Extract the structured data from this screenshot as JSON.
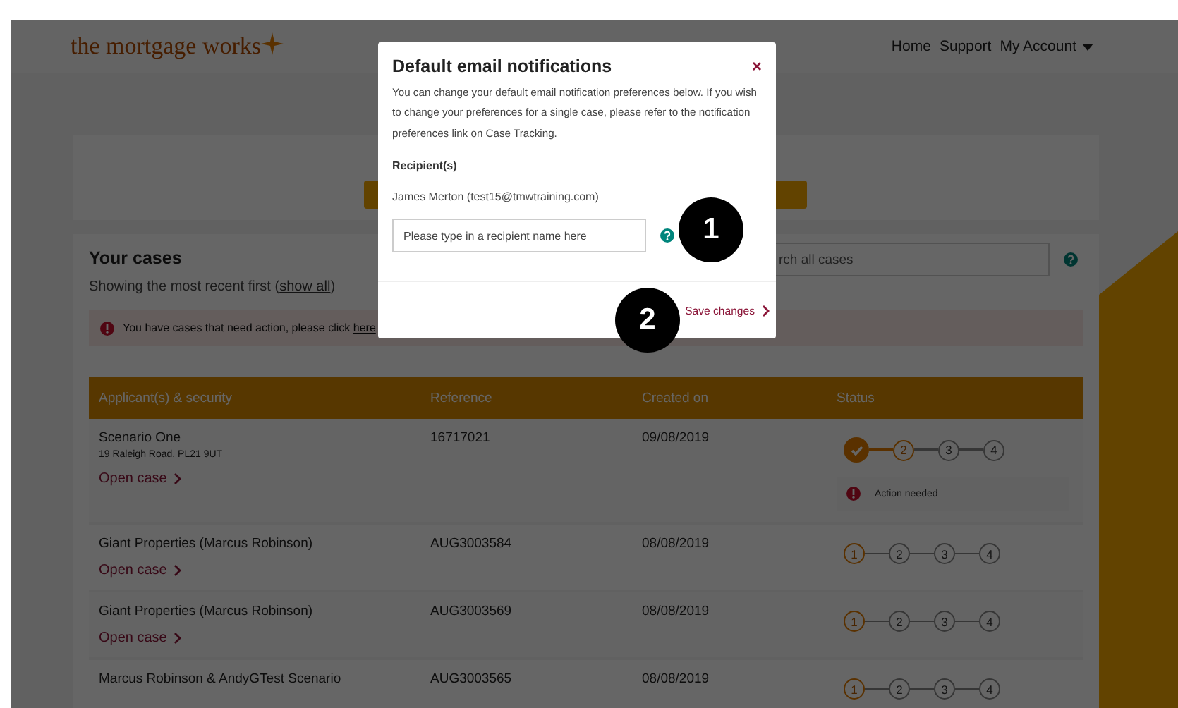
{
  "header": {
    "logo": "the mortgage works",
    "nav": [
      {
        "label": "Home",
        "kind": "link"
      },
      {
        "label": "Support",
        "kind": "link"
      },
      {
        "label": "My Account",
        "kind": "menu"
      }
    ]
  },
  "cases": {
    "title": "Your cases",
    "subtitle": "Showing the most recent first (",
    "show_all": "show all",
    "subtitle_end": ")",
    "search_placeholder": "rch all cases",
    "alert": {
      "text": "You have cases that need action, please click ",
      "link": "here"
    },
    "columns": [
      "Applicant(s) & security",
      "Reference",
      "Created on",
      "Status"
    ],
    "rows": [
      {
        "applicant": "Scenario One",
        "address": "19 Raleigh Road, PL21 9UT",
        "reference": "16717021",
        "created": "09/08/2019",
        "link": "Open case",
        "steps": [
          {
            "completed": true
          },
          {
            "label": "2",
            "completed": false,
            "active": true
          },
          {
            "label": "3",
            "completed": false,
            "active": false
          },
          {
            "label": "4",
            "completed": false,
            "active": false
          }
        ],
        "action": "Action needed"
      },
      {
        "applicant": "Giant Properties (Marcus Robinson)",
        "reference": "AUG3003584",
        "created": "08/08/2019",
        "link": "Open case",
        "steps": [
          {
            "label": "1",
            "completed": false,
            "active": true
          },
          {
            "label": "2",
            "completed": false,
            "active": false
          },
          {
            "label": "3",
            "completed": false,
            "active": false
          },
          {
            "label": "4",
            "completed": false,
            "active": false
          }
        ]
      },
      {
        "applicant": "Giant Properties (Marcus Robinson)",
        "reference": "AUG3003569",
        "created": "08/08/2019",
        "link": "Open case",
        "steps": [
          {
            "label": "1",
            "completed": false,
            "active": true
          },
          {
            "label": "2",
            "completed": false,
            "active": false
          },
          {
            "label": "3",
            "completed": false,
            "active": false
          },
          {
            "label": "4",
            "completed": false,
            "active": false
          }
        ]
      },
      {
        "applicant": "Marcus Robinson & AndyGTest Scenario",
        "reference": "AUG3003565",
        "created": "08/08/2019",
        "steps": [
          {
            "label": "1",
            "completed": false,
            "active": true
          },
          {
            "label": "2",
            "completed": false,
            "active": false
          },
          {
            "label": "3",
            "completed": false,
            "active": false
          },
          {
            "label": "4",
            "completed": false,
            "active": false
          }
        ]
      }
    ]
  },
  "modal": {
    "title": "Default email notifications",
    "close": "×",
    "description": "You can change your default email notification preferences below. If you wish to change your preferences for a single case, please refer to the notification preferences link on Case Tracking.",
    "recipients_label": "Recipient(s)",
    "recipients": [
      "James Merton (test15@tmwtraining.com)"
    ],
    "recipient_placeholder": "Please type in a recipient name here",
    "save": "Save changes"
  },
  "callouts": [
    "1",
    "2"
  ]
}
